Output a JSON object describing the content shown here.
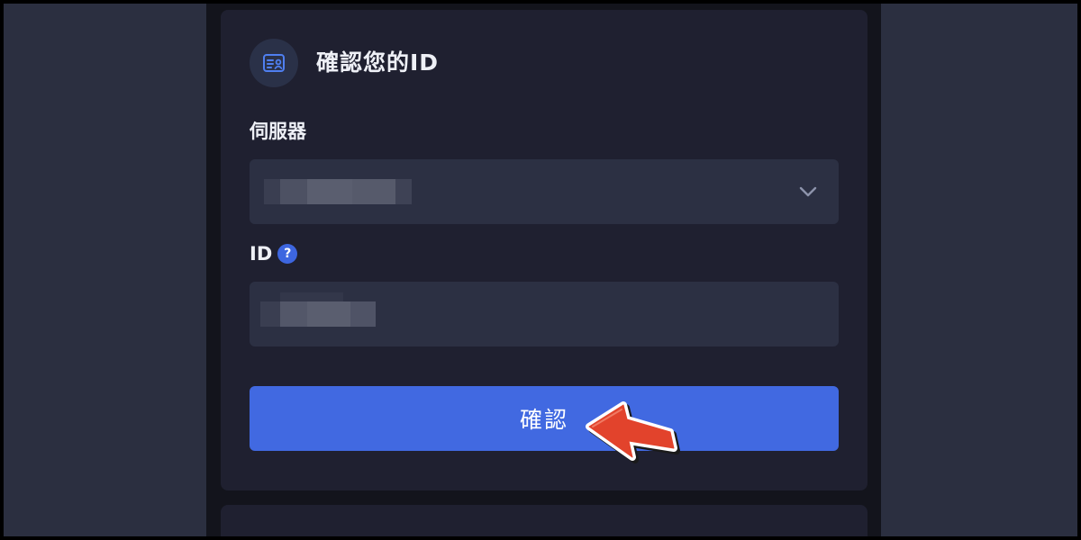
{
  "card": {
    "title": "確認您的ID",
    "icon": "id-card-icon"
  },
  "server_field": {
    "label": "伺服器",
    "value_redacted": true,
    "icon": "chevron-down-icon"
  },
  "id_field": {
    "label": "ID",
    "help": "?",
    "value_redacted": true
  },
  "confirm_button": {
    "label": "確認"
  },
  "annotation": {
    "icon": "red-arrow-pointer-icon",
    "color": "#e2432c"
  },
  "colors": {
    "background": "#2b2f40",
    "card": "#1f2030",
    "field": "#2c3043",
    "accent": "#4169e1",
    "text": "#eef0f6"
  }
}
